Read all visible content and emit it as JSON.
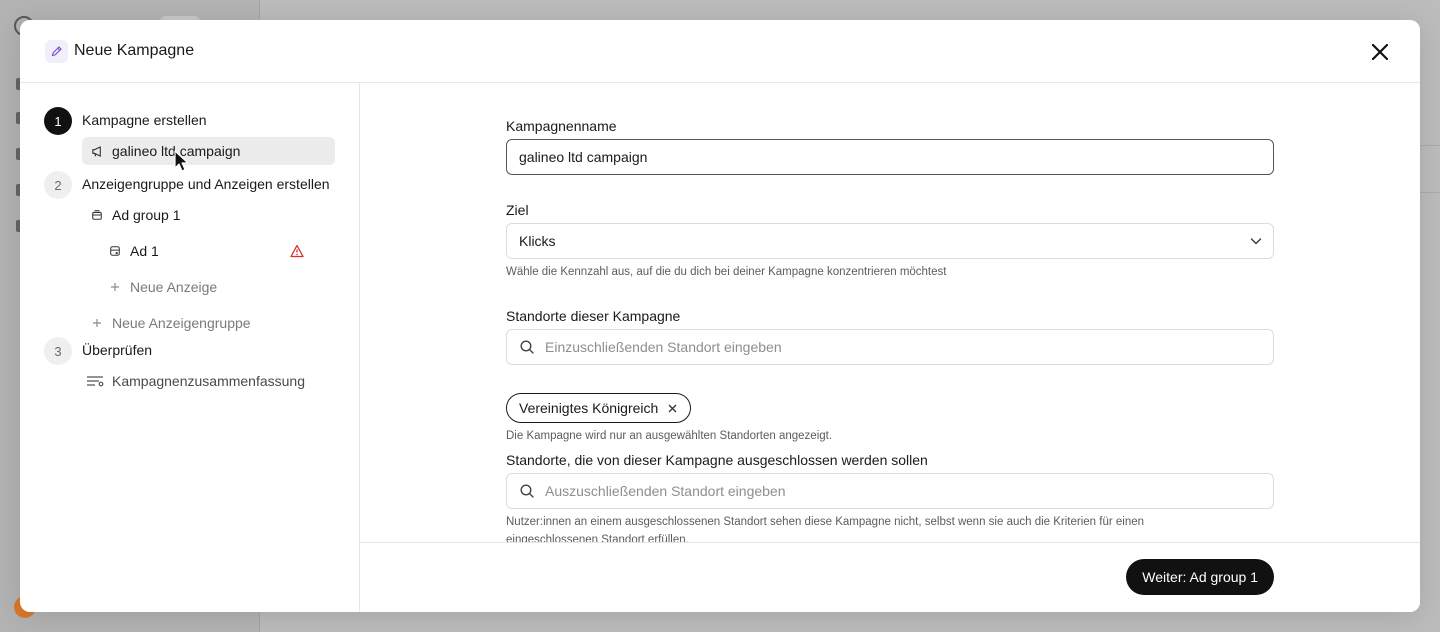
{
  "modal": {
    "title": "Neue Kampagne",
    "header_icon": "pen-icon",
    "close_icon": "close-icon"
  },
  "steps": [
    {
      "number": "1",
      "title": "Kampagne erstellen",
      "state": "active"
    },
    {
      "number": "2",
      "title": "Anzeigengruppe und Anzeigen erstellen",
      "state": "idle"
    },
    {
      "number": "3",
      "title": "Überprüfen",
      "state": "idle"
    }
  ],
  "substeps": {
    "campaign": {
      "label": "galineo ltd campaign",
      "icon": "megaphone-icon"
    },
    "ad_group": {
      "label": "Ad group 1",
      "icon": "ad-group-icon"
    },
    "ad": {
      "label": "Ad 1",
      "icon": "ad-icon",
      "warning_icon": "warning-icon"
    },
    "new_ad": {
      "label": "Neue Anzeige",
      "icon": "plus-icon"
    },
    "new_ad_group": {
      "label": "Neue Anzeigengruppe",
      "icon": "plus-icon"
    },
    "summary": {
      "label": "Kampagnenzusammenfassung",
      "icon": "summary-icon"
    }
  },
  "form": {
    "campaign_name": {
      "label": "Kampagnenname",
      "value": "galineo ltd campaign"
    },
    "goal": {
      "label": "Ziel",
      "value": "Klicks",
      "help": "Wähle die Kennzahl aus, auf die du dich bei deiner Kampagne konzentrieren möchtest"
    },
    "locations": {
      "label": "Standorte dieser Kampagne",
      "placeholder": "Einzuschließenden Standort eingeben",
      "chips": [
        "Vereinigtes Königreich"
      ],
      "help": "Die Kampagne wird nur an ausgewählten Standorten angezeigt."
    },
    "excluded_locations": {
      "label": "Standorte, die von dieser Kampagne ausgeschlossen werden sollen",
      "placeholder": "Auszuschließenden Standort eingeben",
      "help": "Nutzer:innen an einem ausgeschlossenen Standort sehen diese Kampagne nicht, selbst wenn sie auch die Kriterien für einen eingeschlossenen Standort erfüllen."
    }
  },
  "footer": {
    "next_label": "Weiter: Ad group 1"
  },
  "colors": {
    "primary": "#111111",
    "accent_purple": "#7a4fd6",
    "warning": "#d93025"
  }
}
